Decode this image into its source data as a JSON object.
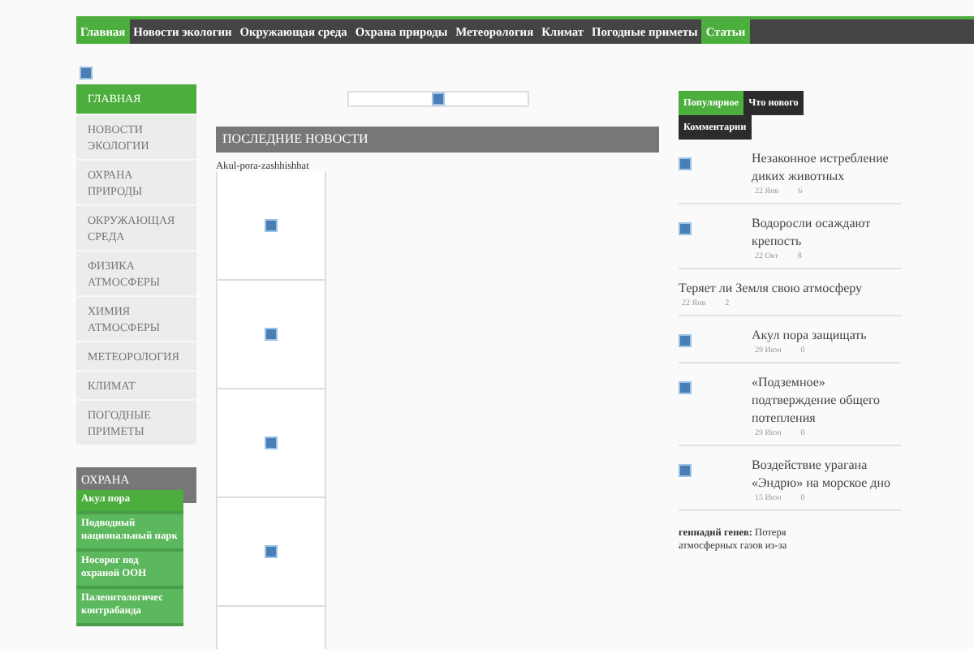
{
  "top_menu": [
    {
      "label": "Главная",
      "selected": true
    },
    {
      "label": "Новости экологии",
      "selected": false
    },
    {
      "label": "Окружающая среда",
      "selected": false
    },
    {
      "label": "Охрана природы",
      "selected": false
    },
    {
      "label": "Метеорология",
      "selected": false
    },
    {
      "label": "Климат",
      "selected": false
    },
    {
      "label": "Погодные приметы",
      "selected": false
    },
    {
      "label": "Статьи",
      "selected": true
    }
  ],
  "side_menu": [
    {
      "label": "ГЛАВНАЯ",
      "selected": true
    },
    {
      "label": "НОВОСТИ ЭКОЛОГИИ",
      "selected": false
    },
    {
      "label": "ОХРАНА ПРИРОДЫ",
      "selected": false
    },
    {
      "label": "ОКРУЖАЮЩАЯ СРЕДА",
      "selected": false
    },
    {
      "label": "ФИЗИКА АТМОСФЕРЫ",
      "selected": false
    },
    {
      "label": "ХИМИЯ АТМОСФЕРЫ",
      "selected": false
    },
    {
      "label": "МЕТЕОРОЛОГИЯ",
      "selected": false
    },
    {
      "label": "КЛИМАТ",
      "selected": false
    },
    {
      "label": "ПОГОДНЫЕ ПРИМЕТЫ",
      "selected": false
    }
  ],
  "side_widget": {
    "title": "ОХРАНА",
    "submenu": [
      "Акул пора",
      "Подводный национальный парк",
      "Носорог под охраной ООН",
      "Палеонтологичес контрабанда"
    ]
  },
  "news": {
    "title": "ПОСЛЕДНИЕ НОВОСТИ",
    "first_caption": "Akul-pora-zashhishhat"
  },
  "tabs": [
    {
      "label": "Популярное",
      "selected": true
    },
    {
      "label": "Что нового",
      "selected": false
    },
    {
      "label": "Комментарии",
      "selected": false
    }
  ],
  "posts": [
    {
      "kind": "thumb",
      "title": "Незаконное истребление диких животных",
      "date": "22 Янв",
      "comments": "6"
    },
    {
      "kind": "thumb",
      "title": "Водоросли осаждают крепость",
      "date": "22 Окт",
      "comments": "8"
    },
    {
      "kind": "plain",
      "title": "Теряет ли Земля свою атмосферу",
      "date": "22 Янв",
      "comments": "2"
    },
    {
      "kind": "thumb",
      "title": "Акул пора защищать",
      "date": "29 Июн",
      "comments": "0"
    },
    {
      "kind": "thumb",
      "title": "«Подземное» подтверждение общего потепления",
      "date": "29 Июн",
      "comments": "0"
    },
    {
      "kind": "thumb",
      "title": "Воздействие урагана «Эндрю» на морское дно",
      "date": "15 Июн",
      "comments": "0"
    }
  ],
  "last_comment": "**геннадий генев:** Потеря атмосферных газов из-за"
}
